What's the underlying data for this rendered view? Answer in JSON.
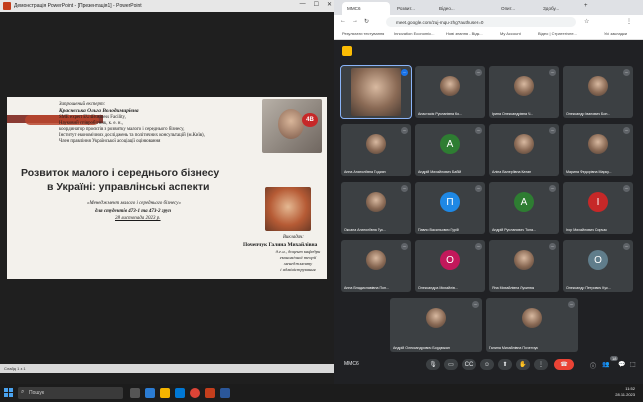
{
  "ppt": {
    "window_title": "Демонстрація PowerPoint - [Презентація1] - PowerPoint",
    "status": "Слайд 1 з 1"
  },
  "slide": {
    "invited_label": "Запрошений експерт:",
    "expert_name": "Краснєська Ольга Володимирівна",
    "expert_lines": [
      "SME expert EU4Business Facility,",
      "Науковий співробітник, к. е. н.,",
      "координатор проєктів з розвитку малого і середнього бізнесу,",
      "Інститут економічних досліджень та політичних консультацій (м.Київ),",
      "Член правління Української асоціації оцінювання"
    ],
    "title_line1": "Розвиток малого і середнього бізнесу",
    "title_line2": "в Україні: управлінські аспекти",
    "course": "«Менеджмент малого і середнього бізнесу»",
    "students": "для студентів 473-1 та 473-2 груп",
    "date": "28 листопада 2023 р.",
    "lecturer_label": "Викладач:",
    "lecturer_name": "Почепчук Галина Михайлівна",
    "lecturer_lines": [
      "д.е.н., доцент кафедри",
      "економічної теорії менеджменту",
      "і адміністрування"
    ]
  },
  "chrome": {
    "tabs": [
      "MMC6",
      "Розвит...",
      "Відео...",
      "",
      "Опит...",
      "Здобу..."
    ],
    "url": "meet.google.com/zuj-mqu-zhg?authuser=0",
    "bookmarks": [
      "Результати тестування",
      "Innovation Economic...",
      "Нові знання - Відк...",
      "My Account",
      "Відео | Стратегічне...",
      "Усі закладки"
    ]
  },
  "meet": {
    "tiles": [
      {
        "name": "",
        "initial": "",
        "color": "#3c4043",
        "photo": true,
        "speaking": true
      },
      {
        "name": "Анастасія Русланівна Ко...",
        "initial": "",
        "color": "#5d4037",
        "photo": true
      },
      {
        "name": "Ірина Олександрівна Ч...",
        "initial": "",
        "color": "#37474f",
        "photo": true
      },
      {
        "name": "Олександр Іванович Бон...",
        "initial": "",
        "color": "#37474f",
        "photo": true
      },
      {
        "name": "Анна Анатоліївна Годиян",
        "initial": "",
        "color": "#37474f",
        "photo": true
      },
      {
        "name": "Андрій Михайлович Бабій",
        "initial": "А",
        "color": "#2e7d32",
        "photo": false
      },
      {
        "name": "Аліна Валеріївна Катан",
        "initial": "",
        "color": "#37474f",
        "photo": true
      },
      {
        "name": "Марина Федорівна Марку...",
        "initial": "",
        "color": "#37474f",
        "photo": true
      },
      {
        "name": "Оксана Анатоліївна Гук...",
        "initial": "",
        "color": "#37474f",
        "photo": true
      },
      {
        "name": "Павло Васильович Гурій",
        "initial": "П",
        "color": "#1e88e5",
        "photo": false
      },
      {
        "name": "Андрій Русланович Тола...",
        "initial": "А",
        "color": "#2e7d32",
        "photo": false
      },
      {
        "name": "Ігор Михайлович Сирчак",
        "initial": "І",
        "color": "#c62828",
        "photo": false
      },
      {
        "name": "Анна Владиславівна Пон...",
        "initial": "",
        "color": "#37474f",
        "photo": true
      },
      {
        "name": "Олександра Михайлів...",
        "initial": "О",
        "color": "#c2185b",
        "photo": false
      },
      {
        "name": "Яна Михайлівна Лукинюк",
        "initial": "",
        "color": "#37474f",
        "photo": true
      },
      {
        "name": "Олександр Петрович Кук...",
        "initial": "О",
        "color": "#607d8b",
        "photo": false
      },
      {
        "name": "Андрій Олександрович Бордюжан",
        "initial": "",
        "color": "#37474f",
        "photo": true
      },
      {
        "name": "Галина Михайлівна Почепчук",
        "initial": "",
        "color": "#37474f",
        "photo": true
      }
    ],
    "meeting_code": "MMC6",
    "participants_count": "18"
  },
  "taskbar": {
    "search_placeholder": "Пошук",
    "time": "11:52",
    "date": "28.11.2023"
  }
}
